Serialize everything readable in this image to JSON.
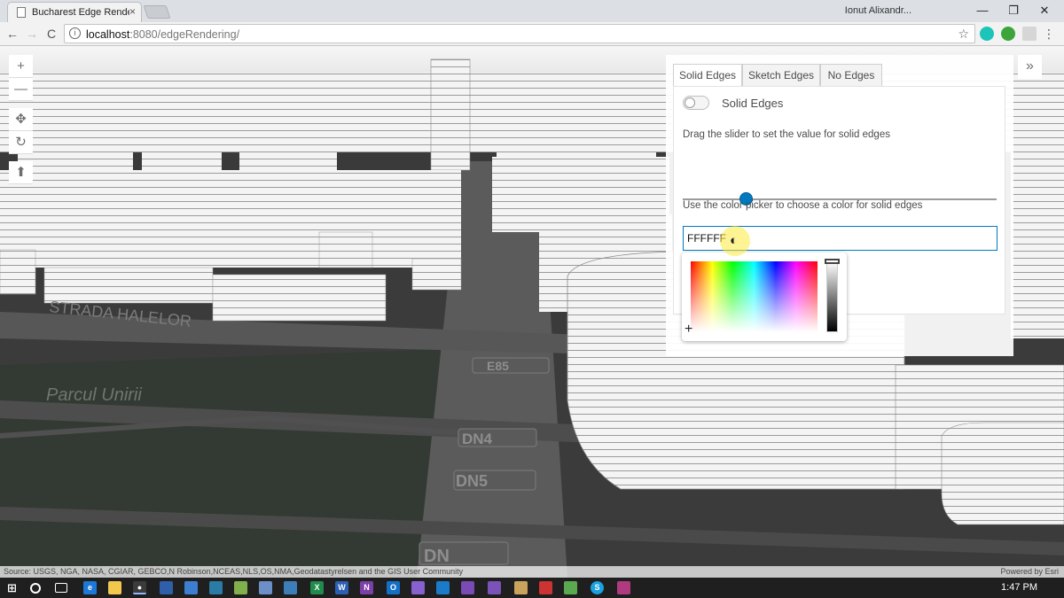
{
  "browser": {
    "tab_title": "Bucharest Edge Rendering",
    "tab_close": "×",
    "user": "Ionut Alixandr...",
    "win_minimize": "—",
    "win_restore": "❐",
    "win_close": "✕",
    "url_host": "localhost",
    "url_rest": ":8080/edgeRendering/",
    "back": "←",
    "forward": "→",
    "reload": "C",
    "bookmark": "☆",
    "menu": "⋮"
  },
  "map": {
    "street_label": "STRADA HALELOR",
    "park_label": "Parcul Unirii",
    "road_e85": "E85",
    "road_dn4": "DN4",
    "road_dn5": "DN5",
    "road_dn": "DN",
    "attribution": "Source: USGS, NGA, NASA, CGIAR, GEBCO,N Robinson,NCEAS,NLS,OS,NMA,Geodatastyrelsen and the GIS User Community",
    "powered_by": "Powered by Esri"
  },
  "view_controls": {
    "zoom_in": "+",
    "zoom_out": "—",
    "pan": "✥",
    "rotate": "↻",
    "compass": "⬆"
  },
  "panel": {
    "expand": "»",
    "tabs": [
      {
        "label": "Solid Edges",
        "active": true
      },
      {
        "label": "Sketch Edges",
        "active": false
      },
      {
        "label": "No Edges",
        "active": false
      }
    ],
    "toggle_label": "Solid Edges",
    "toggle_on": false,
    "slider_label": "Drag the slider to set the value for solid edges",
    "slider_value_fraction": 0.2,
    "color_label": "Use the color picker to choose a color for solid edges",
    "color_value": "FFFFFF",
    "accent_color": "#0079c1"
  },
  "taskbar": {
    "time": "1:47 PM",
    "icons": [
      "windows-start",
      "search",
      "task-view",
      "edge",
      "file-explorer",
      "chrome",
      "app",
      "app",
      "app",
      "app",
      "app",
      "app",
      "app",
      "excel",
      "word",
      "onenote",
      "outlook",
      "app",
      "vscode",
      "visual-studio",
      "app",
      "app",
      "app",
      "app",
      "skype",
      "app"
    ]
  }
}
